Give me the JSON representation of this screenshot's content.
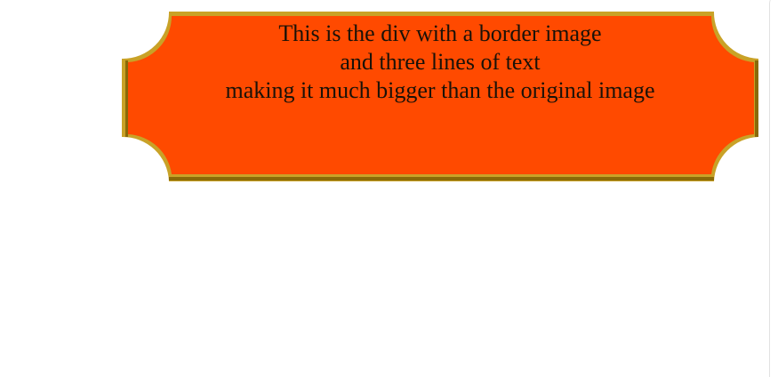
{
  "ticket": {
    "lines": [
      "This is the div with a border image",
      "and three lines of text",
      "making it much bigger than the original image"
    ],
    "fill_color": "#ff4a00",
    "border_light": "#c9a227",
    "border_dark": "#8a6a08",
    "text_color": "#1a1208"
  }
}
